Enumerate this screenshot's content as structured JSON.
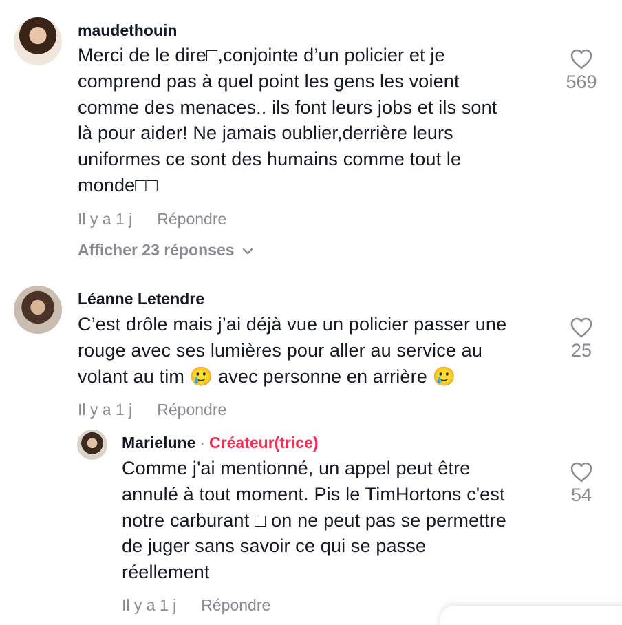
{
  "comments": [
    {
      "username": "maudethouin",
      "lines": [
        "Merci de le dire□,conjointe d’un policier et je",
        "comprend pas à quel point les gens les voient",
        "comme des menaces.. ils font leurs jobs et ils sont",
        "là pour aider! Ne jamais oublier,derrière leurs",
        "uniformes ce sont des humains comme tout le",
        "monde□□"
      ],
      "time": "Il y a 1 j",
      "reply_label": "Répondre",
      "likes": "569",
      "view_replies": "Afficher 23 réponses"
    },
    {
      "username": "Léanne Letendre",
      "lines": [
        "C’est drôle mais j’ai déjà vue un policier passer une",
        "rouge avec ses lumières pour aller au service au",
        "volant au tim 🥲 avec personne en arrière 🥲"
      ],
      "time": "Il y a 1 j",
      "reply_label": "Répondre",
      "likes": "25"
    }
  ],
  "reply": {
    "username": "Marielune",
    "separator": "·",
    "badge": "Créateur(trice)",
    "lines": [
      "Comme j'ai mentionné, un appel peut être",
      "annulé à tout moment. Pis le TimHortons c'est",
      "notre carburant □ on ne peut pas se permettre",
      "de juger sans savoir ce qui se passe",
      "réellement"
    ],
    "time": "Il y a 1 j",
    "reply_label": "Répondre",
    "likes": "54"
  },
  "icons": {
    "like": "heart-outline-icon",
    "expand": "chevron-down-icon"
  },
  "colors": {
    "text": "#161823",
    "muted": "#8a8b91",
    "creator_badge": "#fe2c55"
  }
}
